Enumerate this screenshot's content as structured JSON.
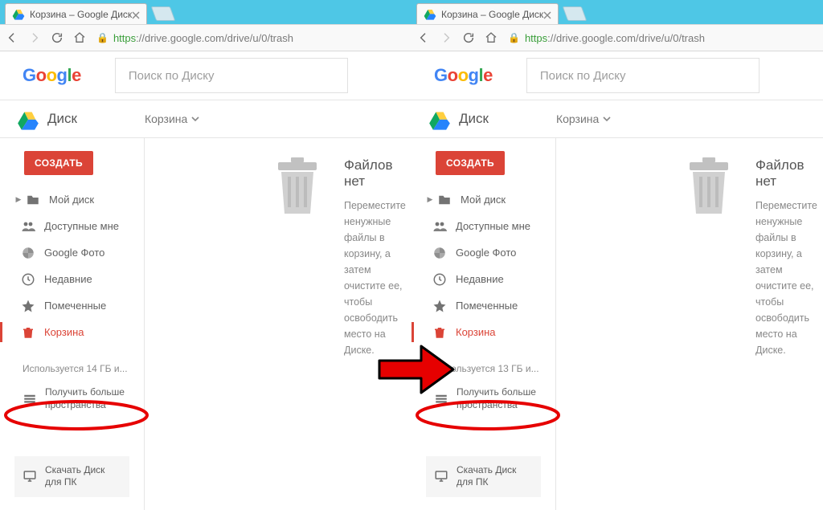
{
  "tab": {
    "title": "Корзина – Google Диск"
  },
  "url": {
    "proto": "https",
    "host": "://drive.google.com",
    "path": "/drive/u/0/trash"
  },
  "page": {
    "logo": [
      "G",
      "o",
      "o",
      "g",
      "l",
      "e"
    ],
    "logo_colors": [
      "b",
      "r",
      "y",
      "b",
      "g",
      "r"
    ],
    "search_ph": "Поиск по Диску",
    "product": "Диск",
    "breadcrumb": "Корзина",
    "create": "СОЗДАТЬ"
  },
  "nav": [
    {
      "key": "mydrive",
      "label": "Мой диск",
      "icon": "folder",
      "tree": true
    },
    {
      "key": "shared",
      "label": "Доступные мне",
      "icon": "people"
    },
    {
      "key": "photos",
      "label": "Google Фото",
      "icon": "pinwheel"
    },
    {
      "key": "recent",
      "label": "Недавние",
      "icon": "clock"
    },
    {
      "key": "starred",
      "label": "Помеченные",
      "icon": "star"
    },
    {
      "key": "trash",
      "label": "Корзина",
      "icon": "trash",
      "active": true
    }
  ],
  "storage": {
    "left": "Используется 14 ГБ и...",
    "right": "Используется 13 ГБ и...",
    "more": "Получить больше пространства"
  },
  "download": "Скачать Диск для ПК",
  "empty": {
    "title": "Файлов нет",
    "line1": "Переместите ненужные файлы в",
    "line2": "корзину, а затем очистите ее, чтобы",
    "line3": "освободить место на Диске."
  }
}
